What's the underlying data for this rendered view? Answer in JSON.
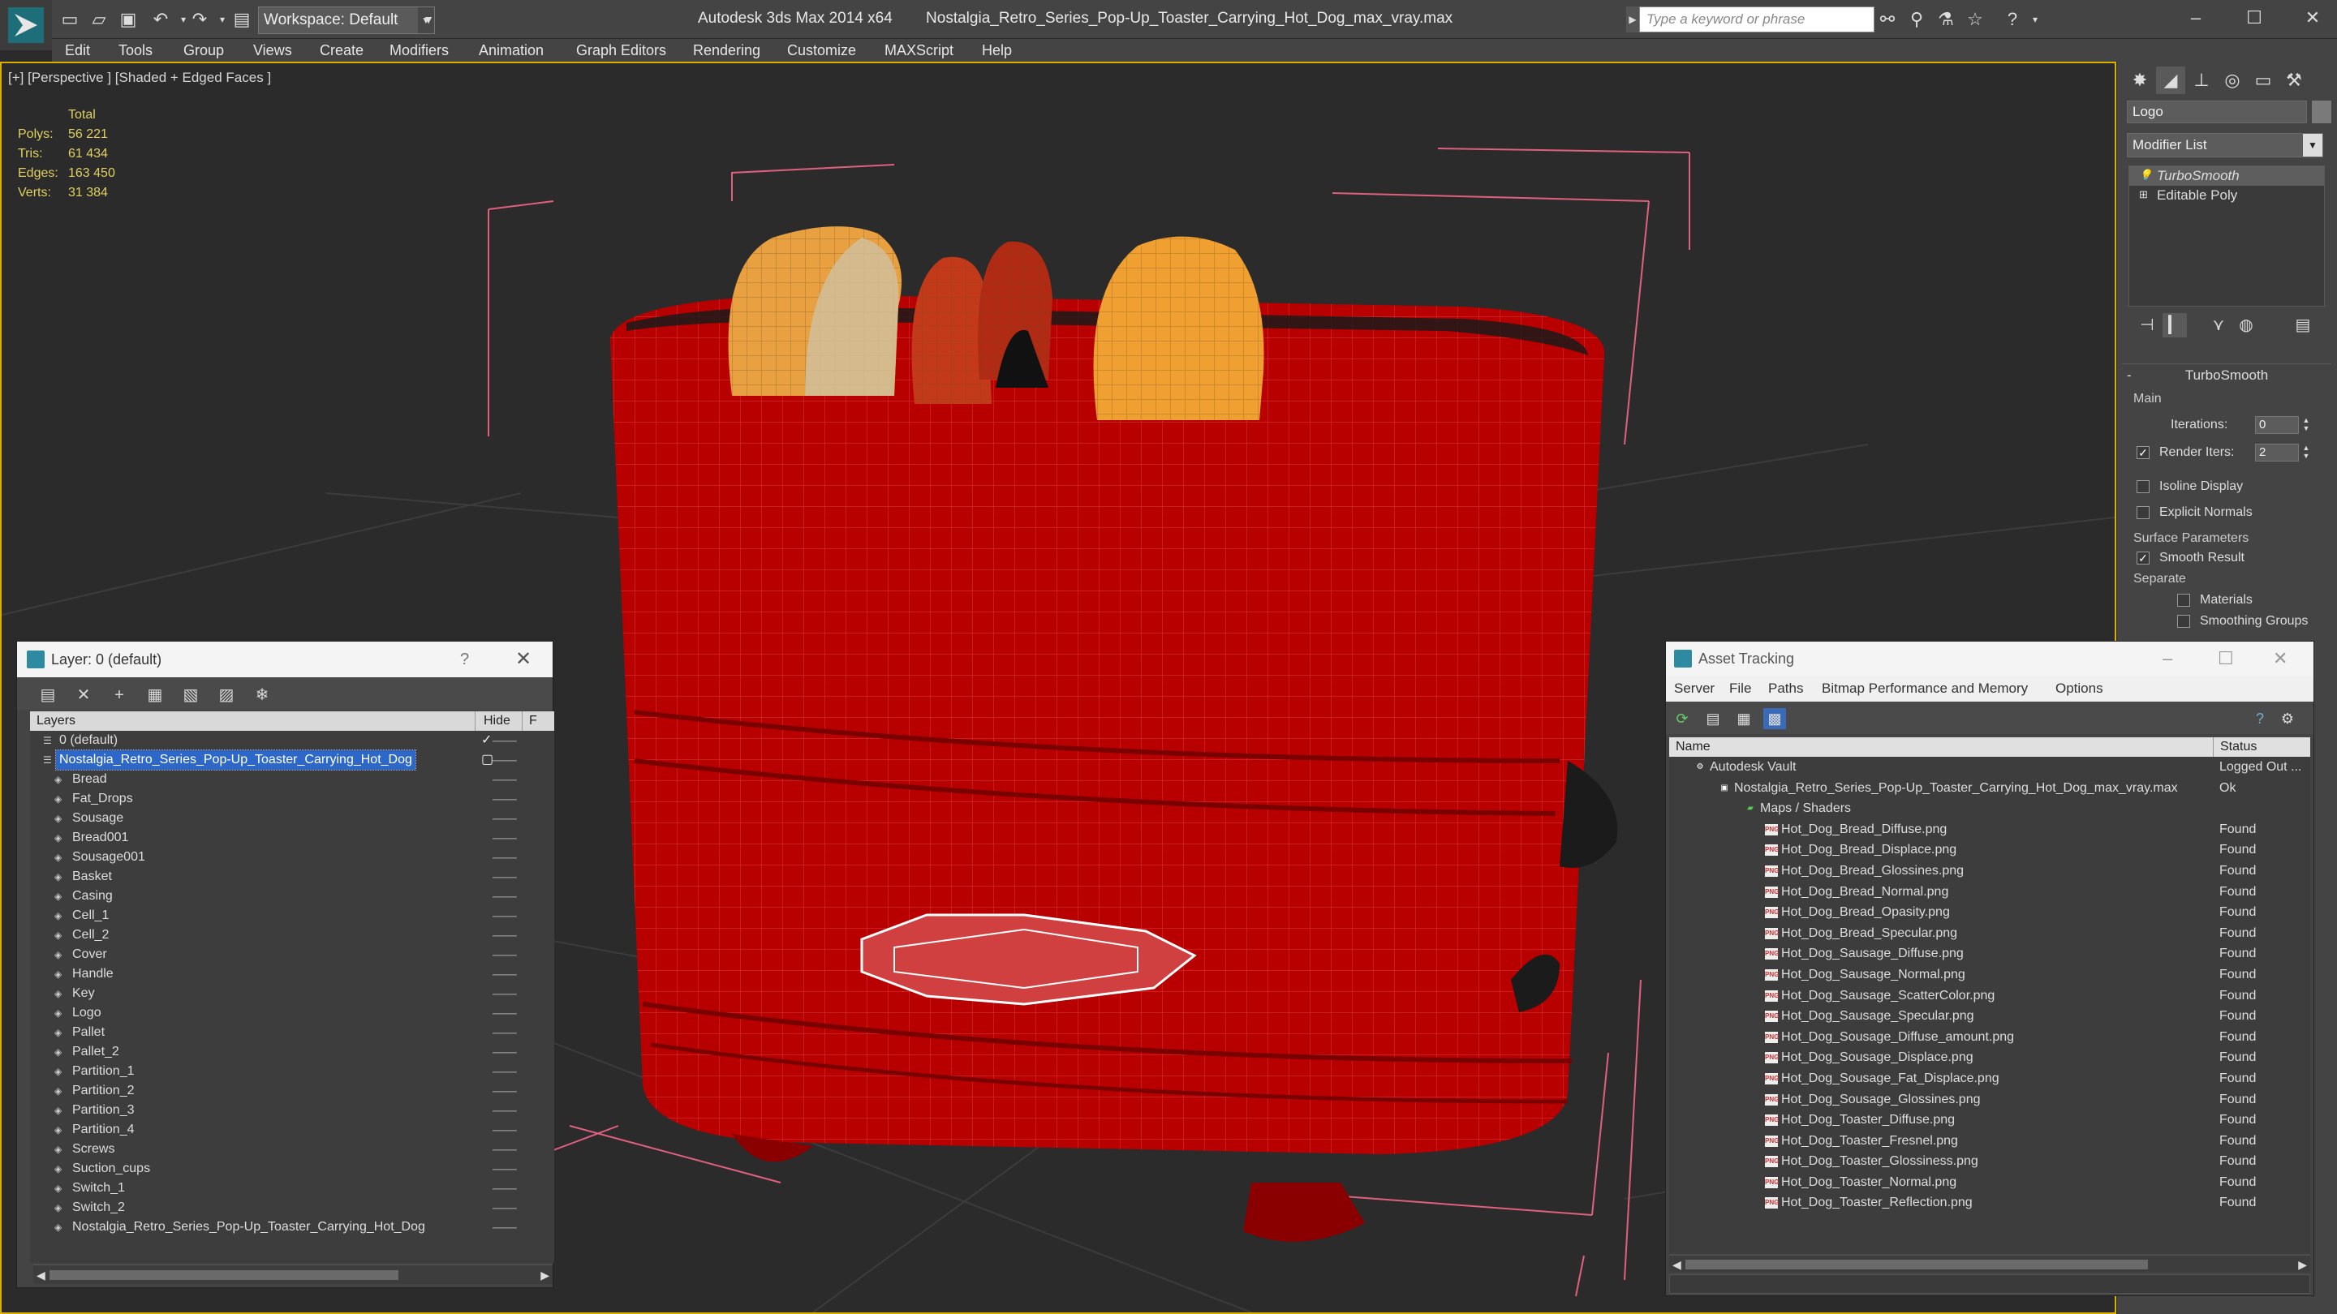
{
  "titlebar": {
    "workspace": "Workspace: Default",
    "app_name": "Autodesk 3ds Max  2014 x64",
    "file_name": "Nostalgia_Retro_Series_Pop-Up_Toaster_Carrying_Hot_Dog_max_vray.max",
    "search_placeholder": "Type a keyword or phrase"
  },
  "menu": [
    "Edit",
    "Tools",
    "Group",
    "Views",
    "Create",
    "Modifiers",
    "Animation",
    "Graph Editors",
    "Rendering",
    "Customize",
    "MAXScript",
    "Help"
  ],
  "viewport": {
    "label": "[+] [Perspective ] [Shaded + Edged Faces ]",
    "stats": {
      "header": "Total",
      "rows": [
        {
          "k": "Polys:",
          "v": "56 221"
        },
        {
          "k": "Tris:",
          "v": "61 434"
        },
        {
          "k": "Edges:",
          "v": "163 450"
        },
        {
          "k": "Verts:",
          "v": "31 384"
        }
      ]
    },
    "colors": {
      "body": "#b80000",
      "bread": "#e8a040",
      "sausage": "#c23a1a",
      "background": "#2b2b2b"
    }
  },
  "command_panel": {
    "object_name": "Logo",
    "modifier_list": "Modifier List",
    "stack": [
      {
        "label": "TurboSmooth",
        "selected": true
      },
      {
        "label": "Editable Poly",
        "selected": false
      }
    ],
    "turbosmooth": {
      "title": "TurboSmooth",
      "main_label": "Main",
      "iterations_label": "Iterations:",
      "iterations_value": "0",
      "render_iters_label": "Render Iters:",
      "render_iters_value": "2",
      "isoline": "Isoline Display",
      "explicit": "Explicit Normals",
      "surface_label": "Surface Parameters",
      "smooth_result": "Smooth Result",
      "separate": "Separate",
      "materials": "Materials",
      "smoothing_groups": "Smoothing Groups"
    }
  },
  "layer_dialog": {
    "title": "Layer: 0 (default)",
    "help": "?",
    "columns": {
      "layers": "Layers",
      "hide": "Hide",
      "freeze": "F"
    },
    "rows": [
      {
        "name": "0 (default)",
        "indent": 0,
        "type": "layer",
        "check": true
      },
      {
        "name": "Nostalgia_Retro_Series_Pop-Up_Toaster_Carrying_Hot_Dog",
        "indent": 0,
        "type": "layer",
        "selected": true
      },
      {
        "name": "Bread",
        "indent": 1,
        "type": "obj"
      },
      {
        "name": "Fat_Drops",
        "indent": 1,
        "type": "obj"
      },
      {
        "name": "Sousage",
        "indent": 1,
        "type": "obj"
      },
      {
        "name": "Bread001",
        "indent": 1,
        "type": "obj"
      },
      {
        "name": "Sousage001",
        "indent": 1,
        "type": "obj"
      },
      {
        "name": "Basket",
        "indent": 1,
        "type": "obj"
      },
      {
        "name": "Casing",
        "indent": 1,
        "type": "obj"
      },
      {
        "name": "Cell_1",
        "indent": 1,
        "type": "obj"
      },
      {
        "name": "Cell_2",
        "indent": 1,
        "type": "obj"
      },
      {
        "name": "Cover",
        "indent": 1,
        "type": "obj"
      },
      {
        "name": "Handle",
        "indent": 1,
        "type": "obj"
      },
      {
        "name": "Key",
        "indent": 1,
        "type": "obj"
      },
      {
        "name": "Logo",
        "indent": 1,
        "type": "obj"
      },
      {
        "name": "Pallet",
        "indent": 1,
        "type": "obj"
      },
      {
        "name": "Pallet_2",
        "indent": 1,
        "type": "obj"
      },
      {
        "name": "Partition_1",
        "indent": 1,
        "type": "obj"
      },
      {
        "name": "Partition_2",
        "indent": 1,
        "type": "obj"
      },
      {
        "name": "Partition_3",
        "indent": 1,
        "type": "obj"
      },
      {
        "name": "Partition_4",
        "indent": 1,
        "type": "obj"
      },
      {
        "name": "Screws",
        "indent": 1,
        "type": "obj"
      },
      {
        "name": "Suction_cups",
        "indent": 1,
        "type": "obj"
      },
      {
        "name": "Switch_1",
        "indent": 1,
        "type": "obj"
      },
      {
        "name": "Switch_2",
        "indent": 1,
        "type": "obj"
      },
      {
        "name": "Nostalgia_Retro_Series_Pop-Up_Toaster_Carrying_Hot_Dog",
        "indent": 1,
        "type": "obj"
      }
    ]
  },
  "asset_dialog": {
    "title": "Asset Tracking",
    "menu": [
      "Server",
      "File",
      "Paths",
      "Bitmap Performance and Memory",
      "Options"
    ],
    "columns": {
      "name": "Name",
      "status": "Status"
    },
    "rows": [
      {
        "name": "Autodesk Vault",
        "status": "Logged Out ...",
        "indent": 0,
        "type": "vault"
      },
      {
        "name": "Nostalgia_Retro_Series_Pop-Up_Toaster_Carrying_Hot_Dog_max_vray.max",
        "status": "Ok",
        "indent": 1,
        "type": "max"
      },
      {
        "name": "Maps / Shaders",
        "status": "",
        "indent": 2,
        "type": "folder"
      },
      {
        "name": "Hot_Dog_Bread_Diffuse.png",
        "status": "Found",
        "indent": 3,
        "type": "png"
      },
      {
        "name": "Hot_Dog_Bread_Displace.png",
        "status": "Found",
        "indent": 3,
        "type": "png"
      },
      {
        "name": "Hot_Dog_Bread_Glossines.png",
        "status": "Found",
        "indent": 3,
        "type": "png"
      },
      {
        "name": "Hot_Dog_Bread_Normal.png",
        "status": "Found",
        "indent": 3,
        "type": "png"
      },
      {
        "name": "Hot_Dog_Bread_Opasity.png",
        "status": "Found",
        "indent": 3,
        "type": "png"
      },
      {
        "name": "Hot_Dog_Bread_Specular.png",
        "status": "Found",
        "indent": 3,
        "type": "png"
      },
      {
        "name": "Hot_Dog_Sausage_Diffuse.png",
        "status": "Found",
        "indent": 3,
        "type": "png"
      },
      {
        "name": "Hot_Dog_Sausage_Normal.png",
        "status": "Found",
        "indent": 3,
        "type": "png"
      },
      {
        "name": "Hot_Dog_Sausage_ScatterColor.png",
        "status": "Found",
        "indent": 3,
        "type": "png"
      },
      {
        "name": "Hot_Dog_Sausage_Specular.png",
        "status": "Found",
        "indent": 3,
        "type": "png"
      },
      {
        "name": "Hot_Dog_Sousage_Diffuse_amount.png",
        "status": "Found",
        "indent": 3,
        "type": "png"
      },
      {
        "name": "Hot_Dog_Sousage_Displace.png",
        "status": "Found",
        "indent": 3,
        "type": "png"
      },
      {
        "name": "Hot_Dog_Sousage_Fat_Displace.png",
        "status": "Found",
        "indent": 3,
        "type": "png"
      },
      {
        "name": "Hot_Dog_Sousage_Glossines.png",
        "status": "Found",
        "indent": 3,
        "type": "png"
      },
      {
        "name": "Hot_Dog_Toaster_Diffuse.png",
        "status": "Found",
        "indent": 3,
        "type": "png"
      },
      {
        "name": "Hot_Dog_Toaster_Fresnel.png",
        "status": "Found",
        "indent": 3,
        "type": "png"
      },
      {
        "name": "Hot_Dog_Toaster_Glossiness.png",
        "status": "Found",
        "indent": 3,
        "type": "png"
      },
      {
        "name": "Hot_Dog_Toaster_Normal.png",
        "status": "Found",
        "indent": 3,
        "type": "png"
      },
      {
        "name": "Hot_Dog_Toaster_Reflection.png",
        "status": "Found",
        "indent": 3,
        "type": "png"
      }
    ]
  }
}
